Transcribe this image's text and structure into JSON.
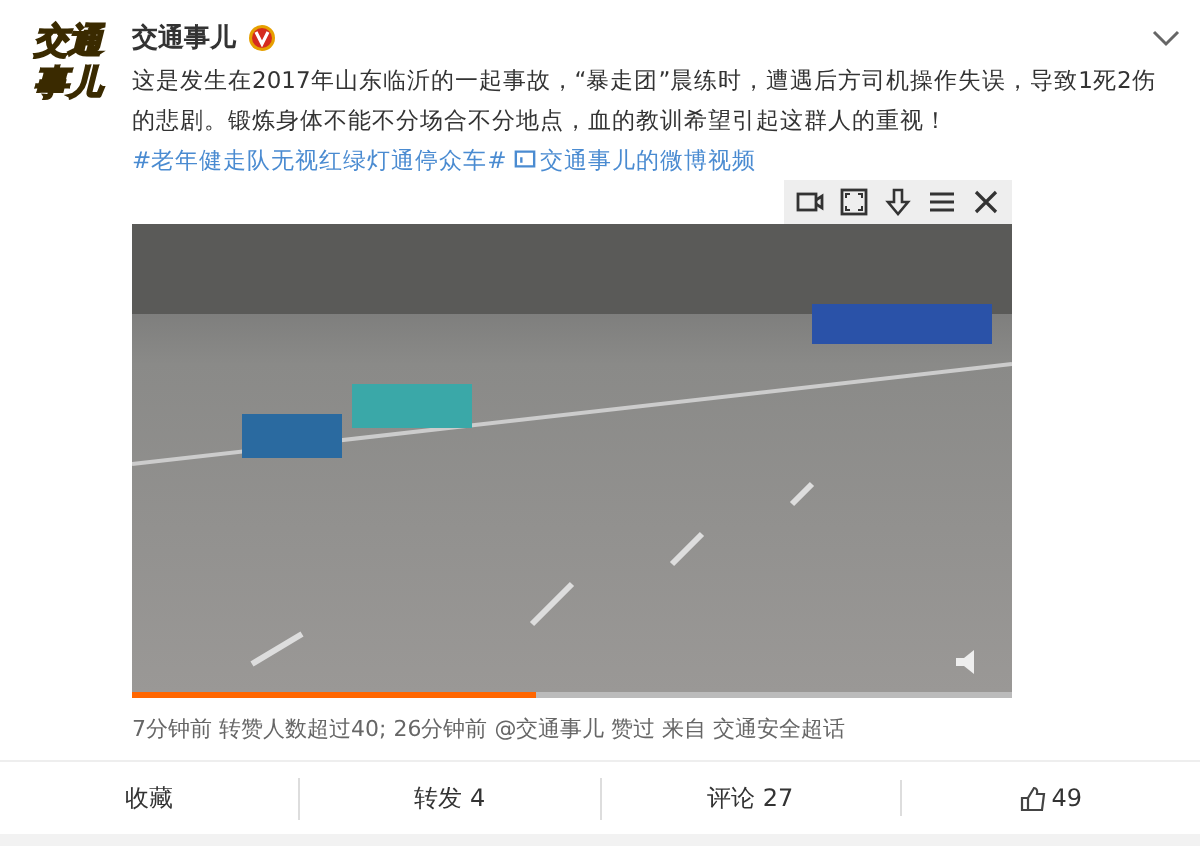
{
  "post": {
    "logo_lines": [
      "交通",
      "事儿"
    ],
    "author": "交通事儿",
    "verified": true,
    "text": [
      {
        "kind": "text",
        "value": "这是发生在2017年山东临沂的一起事故，“暴走团”晨练时，遭遇后方司机操作失误，导致1死2伤的悲剧。锻炼身体不能不分场合不分地点，血的教训希望引起这群人的重视！"
      },
      {
        "kind": "topic",
        "value": "#老年健走队无视红绿灯通停众车#"
      },
      {
        "kind": "video_link",
        "value": "交通事儿的微博视频"
      }
    ],
    "video": {
      "progress": {
        "level": 0.46
      }
    },
    "meta": "7分钟前 转赞人数超过40; 26分钟前 @交通事儿 赞过  来自 交通安全超话"
  },
  "actions": [
    {
      "kind": "favorite",
      "label": "收藏"
    },
    {
      "kind": "repost",
      "label": "转发 4"
    },
    {
      "kind": "comment",
      "label": "评论 27"
    },
    {
      "kind": "like",
      "label": "49"
    }
  ]
}
